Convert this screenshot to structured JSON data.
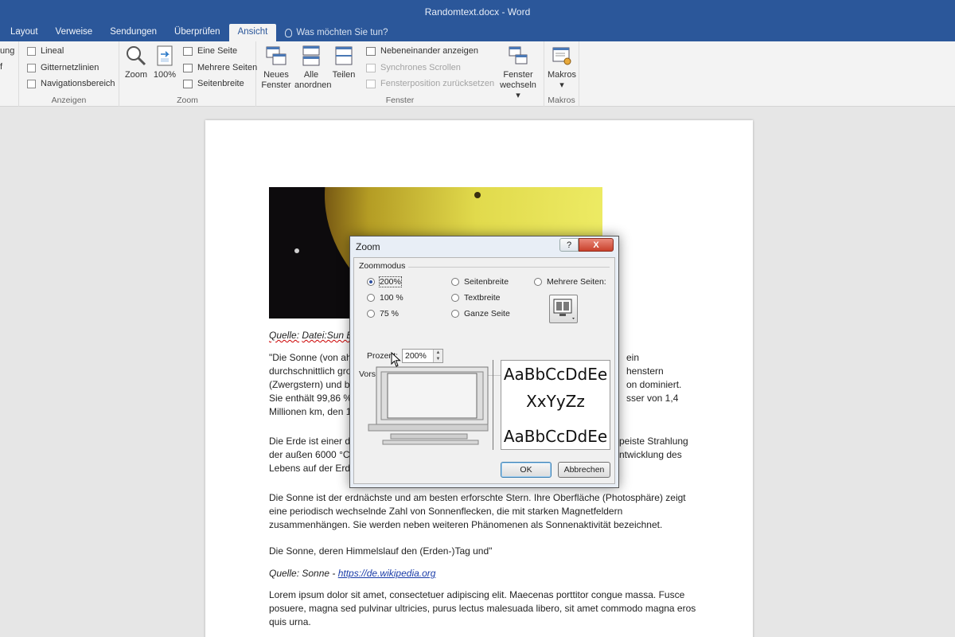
{
  "window": {
    "title": "Randomtext.docx - Word"
  },
  "tabs": [
    {
      "label": "Layout",
      "active": false
    },
    {
      "label": "Verweise",
      "active": false
    },
    {
      "label": "Sendungen",
      "active": false
    },
    {
      "label": "Überprüfen",
      "active": false
    },
    {
      "label": "Ansicht",
      "active": true
    }
  ],
  "tell_me": "Was möchten Sie tun?",
  "ribbon": {
    "cut_labels": [
      "ung",
      "f"
    ],
    "anzeigen": {
      "label": "Anzeigen",
      "items": [
        "Lineal",
        "Gitternetzlinien",
        "Navigationsbereich"
      ]
    },
    "zoom": {
      "label": "Zoom",
      "zoom_button": "Zoom",
      "percent_button": "100%",
      "small": [
        "Eine Seite",
        "Mehrere Seiten",
        "Seitenbreite"
      ]
    },
    "fenster": {
      "label": "Fenster",
      "new_window": [
        "Neues",
        "Fenster"
      ],
      "arrange_all": [
        "Alle",
        "anordnen"
      ],
      "split": "Teilen",
      "small": [
        "Nebeneinander anzeigen",
        "Synchrones Scrollen",
        "Fensterposition zurücksetzen"
      ],
      "switch": [
        "Fenster",
        "wechseln"
      ]
    },
    "makros": {
      "label": "Makros",
      "button": "Makros"
    }
  },
  "document": {
    "caption1_prefix": "Quelle:",
    "caption1_rest": "Datei:Sun E",
    "para1": [
      "\"Die Sonne (von ahd",
      "durchschnittlich gro",
      "(Zwergstern) und bi",
      "Sie enthält 99,86 %",
      "Millionen km, den 1"
    ],
    "para1_right": [
      "ein",
      "henstern",
      "on dominiert.",
      "sser von 1,4",
      ""
    ],
    "para2": [
      "Die Erde ist einer de",
      "der außen 6000 °C h",
      "Lebens auf der Erde"
    ],
    "para2_right": [
      "peiste Strahlung",
      "ntwicklung des",
      ""
    ],
    "para3": [
      "Die Sonne ist der erdnächste und am besten erforschte Stern. Ihre Oberfläche (Photosphäre) zeigt",
      "eine periodisch wechselnde Zahl von Sonnenflecken, die mit starken Magnetfeldern",
      "zusammenhängen. Sie werden neben weiteren Phänomenen als Sonnenaktivität bezeichnet."
    ],
    "para4": "Die Sonne, deren Himmelslauf den (Erden-)Tag und\"",
    "caption2_prefix": "Quelle: Sonne - ",
    "caption2_link": "https://de.wikipedia.org",
    "para5": [
      "Lorem ipsum dolor sit amet, consectetuer adipiscing elit. Maecenas porttitor congue massa. Fusce",
      "posuere, magna sed pulvinar ultricies, purus lectus malesuada libero, sit amet commodo magna eros",
      "quis urna."
    ]
  },
  "dialog": {
    "title": "Zoom",
    "help": "?",
    "close": "X",
    "zoommodus_label": "Zoommodus",
    "options": {
      "p200": "200%",
      "p100": "100 %",
      "p75": "75 %",
      "seitenbreite": "Seitenbreite",
      "textbreite": "Textbreite",
      "ganze_seite": "Ganze Seite",
      "mehrere_seiten": "Mehrere Seiten:"
    },
    "selected": "200%",
    "prozent_label": "Prozent:",
    "prozent_value": "200%",
    "vorschau_label": "Vorschau",
    "preview_text": [
      "AaBbCcDdEe",
      "XxYyZz",
      "AaBbCcDdEe"
    ],
    "ok": "OK",
    "cancel": "Abbrechen"
  },
  "colors": {
    "word_blue": "#2b579a",
    "ribbon": "#f3f3f3",
    "workspace": "#e6e6e6"
  }
}
